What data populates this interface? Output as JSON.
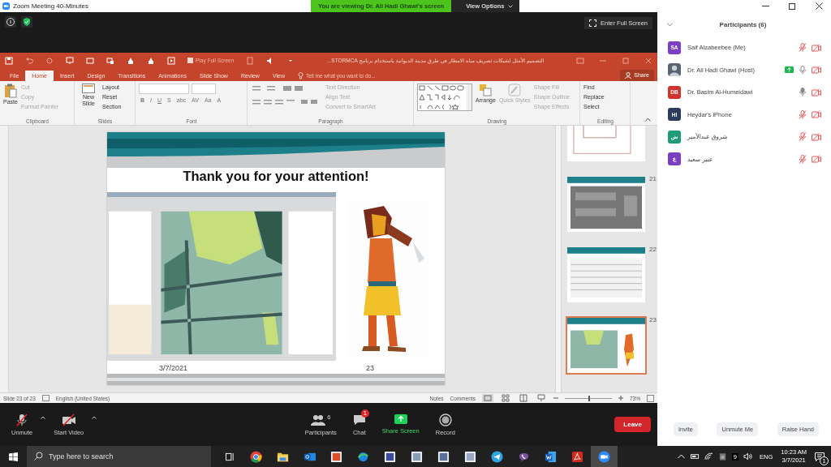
{
  "window": {
    "title": "Zoom Meeting 40-Minutes"
  },
  "banner": {
    "text": "You are viewing Dr. Ali Hadi Ghawi's screen",
    "view_options": "View Options"
  },
  "fullscreen_button": "Enter Full Screen",
  "powerpoint": {
    "document_title": "التصميم الأمثل لشبكات تصريف مياه الامطار في طرق مدينة الديوانية باستخدام برنامج STORMCA...",
    "play_full_screen": {
      "label": "Play Full Screen",
      "checked": false
    },
    "tabs": [
      {
        "label": "File",
        "selected": false
      },
      {
        "label": "Home",
        "selected": true
      },
      {
        "label": "Insert",
        "selected": false
      },
      {
        "label": "Design",
        "selected": false
      },
      {
        "label": "Transitions",
        "selected": false
      },
      {
        "label": "Animations",
        "selected": false
      },
      {
        "label": "Slide Show",
        "selected": false
      },
      {
        "label": "Review",
        "selected": false
      },
      {
        "label": "View",
        "selected": false
      }
    ],
    "tell_me": "Tell me what you want to do...",
    "share": "Share",
    "clipboard": {
      "label": "Clipboard",
      "paste": "Paste",
      "items": [
        {
          "label": "Cut",
          "disabled": true
        },
        {
          "label": "Copy",
          "disabled": true
        },
        {
          "label": "Format Painter",
          "disabled": true
        }
      ]
    },
    "slides": {
      "label": "Slides",
      "new_slide": "New Slide",
      "items": [
        {
          "label": "Layout",
          "disabled": false
        },
        {
          "label": "Reset",
          "disabled": false
        },
        {
          "label": "Section",
          "disabled": false
        }
      ]
    },
    "font": {
      "label": "Font",
      "buttons": [
        "B",
        "I",
        "U",
        "S",
        "abc",
        "AV",
        "Aa",
        "A"
      ]
    },
    "paragraph": {
      "label": "Paragraph",
      "items": [
        {
          "label": "Text Direction",
          "disabled": true
        },
        {
          "label": "Align Text",
          "disabled": true
        },
        {
          "label": "Convert to SmartArt",
          "disabled": true
        }
      ]
    },
    "drawing": {
      "label": "Drawing",
      "arrange": "Arrange",
      "quick_styles": {
        "label": "Quick Styles",
        "disabled": true
      },
      "items": [
        {
          "label": "Shape Fill",
          "disabled": true
        },
        {
          "label": "Shape Outline",
          "disabled": true
        },
        {
          "label": "Shape Effects",
          "disabled": true
        }
      ]
    },
    "editing": {
      "label": "Editing",
      "items": [
        {
          "label": "Find",
          "disabled": false
        },
        {
          "label": "Replace",
          "disabled": false
        },
        {
          "label": "Select",
          "disabled": false
        }
      ]
    },
    "slide": {
      "title": "Thank you for your attention!",
      "date": "3/7/2021",
      "number": "23"
    },
    "thumbnails": [
      {
        "selected": false
      },
      {
        "number": "21",
        "selected": false
      },
      {
        "number": "22",
        "selected": false
      },
      {
        "number": "23",
        "selected": true
      }
    ],
    "status": {
      "slide_info": "Slide 23 of 23",
      "language": "English (United States)",
      "notes": "Notes",
      "comments": "Comments",
      "zoom": "73%",
      "zoom_slider": {
        "level": 0.5
      }
    }
  },
  "toolbar": {
    "unmute": "Unmute",
    "start_video": "Start Video",
    "participants": {
      "label": "Participants",
      "count": "6"
    },
    "chat": {
      "label": "Chat",
      "badge": "1"
    },
    "share_screen": "Share Screen",
    "record": "Record",
    "leave": "Leave"
  },
  "panel": {
    "title": "Participants (6)",
    "people": [
      {
        "name": "Saif Alzabeebee (Me)",
        "initials": "SA",
        "color": "#7b3fc4",
        "photo": false,
        "muted": true,
        "video_off": true,
        "sharing": false
      },
      {
        "name": "Dr. Ali Hadi Ghawi (Host)",
        "photo": true,
        "muted": false,
        "video_off": true,
        "sharing": true
      },
      {
        "name": "Dr. Basim Al-Humeidawi",
        "initials": "DB",
        "color": "#d0342c",
        "photo": false,
        "muted": false,
        "video_off": true,
        "sharing": false
      },
      {
        "name": "Heydar's iPhone",
        "initials": "HI",
        "color": "#2b3d5c",
        "photo": false,
        "muted": true,
        "video_off": true,
        "sharing": false
      },
      {
        "name": "شروق عبدالأمير",
        "initials": "ش",
        "color": "#1e9c7a",
        "photo": false,
        "muted": true,
        "video_off": true,
        "sharing": false
      },
      {
        "name": "عبير سعيد",
        "initials": "ع",
        "color": "#7b3fc4",
        "photo": false,
        "muted": true,
        "video_off": true,
        "sharing": false
      }
    ],
    "buttons": [
      "Invite",
      "Unmute Me",
      "Raise Hand"
    ]
  },
  "taskbar": {
    "search_placeholder": "Type here to search",
    "apps": [
      {
        "kind": "browser",
        "selected": false
      },
      {
        "kind": "folder",
        "selected": false
      },
      {
        "kind": "mail",
        "selected": false
      },
      {
        "kind": "tile",
        "color": "#e04b2c",
        "selected": false
      },
      {
        "kind": "globe",
        "selected": false
      },
      {
        "kind": "tile",
        "color": "#3b4a9c",
        "selected": false
      },
      {
        "kind": "tile",
        "color": "#8a9bb8",
        "selected": false
      },
      {
        "kind": "tile",
        "color": "#5a6f9a",
        "selected": false
      },
      {
        "kind": "tile",
        "color": "#9aa8c0",
        "selected": false
      },
      {
        "kind": "plane",
        "selected": false
      },
      {
        "kind": "phone",
        "selected": false
      },
      {
        "kind": "document",
        "selected": false
      },
      {
        "kind": "pdf",
        "selected": false
      },
      {
        "kind": "camera",
        "selected": true
      }
    ],
    "tray_number": "9",
    "language": "ENG",
    "time": "10:23 AM",
    "date": "3/7/2021",
    "notifications": "1"
  }
}
